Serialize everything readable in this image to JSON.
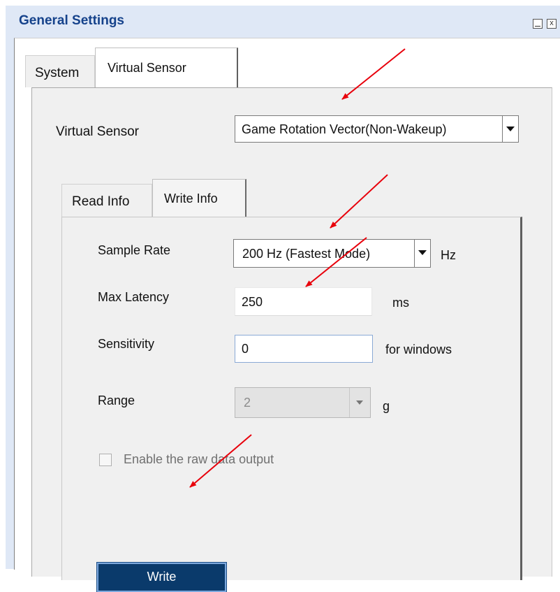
{
  "window": {
    "title": "General Settings",
    "minimize_glyph": "_",
    "close_glyph": "x"
  },
  "tabs": [
    {
      "label": "System",
      "active": false
    },
    {
      "label": "Virtual Sensor",
      "active": true
    }
  ],
  "virtual_sensor": {
    "label": "Virtual Sensor",
    "selected": "Game Rotation Vector(Non-Wakeup)"
  },
  "inner_tabs": [
    {
      "label": "Read Info",
      "active": false
    },
    {
      "label": "Write Info",
      "active": true
    }
  ],
  "write_info": {
    "sample_rate": {
      "label": "Sample Rate",
      "value": "200 Hz (Fastest Mode)",
      "unit": "Hz"
    },
    "max_latency": {
      "label": "Max Latency",
      "value": "250",
      "unit": "ms"
    },
    "sensitivity": {
      "label": "Sensitivity",
      "value": "0",
      "unit": "for windows"
    },
    "range": {
      "label": "Range",
      "value": "2",
      "unit": "g",
      "disabled": true
    },
    "raw_output": {
      "label": "Enable the raw data output",
      "checked": false,
      "disabled": true
    },
    "write_button": "Write"
  },
  "annotation_color": "#e8000b",
  "icons": [
    "dropdown-arrow-icon",
    "minimize-icon",
    "close-icon",
    "annotation-arrow"
  ]
}
